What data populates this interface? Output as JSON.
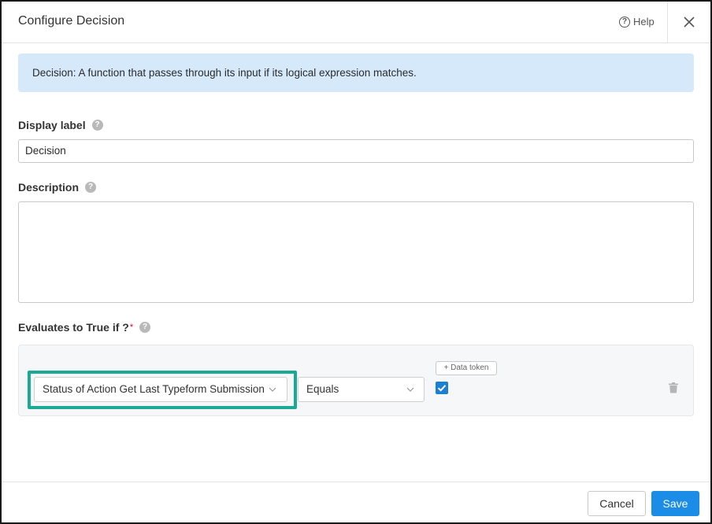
{
  "dialog": {
    "title": "Configure Decision",
    "help_label": "Help"
  },
  "info_banner": {
    "text": "Decision: A function that passes through its input if its logical expression matches."
  },
  "fields": {
    "display_label": {
      "label": "Display label",
      "value": "Decision"
    },
    "description": {
      "label": "Description",
      "value": ""
    },
    "evaluates": {
      "label": "Evaluates to True if ?",
      "required_mark": "*"
    }
  },
  "condition": {
    "left_operand": "Status of Action Get Last Typeform Submission",
    "operator": "Equals",
    "data_token_label": "+ Data token",
    "value_checked": true
  },
  "footer": {
    "cancel_label": "Cancel",
    "save_label": "Save"
  },
  "colors": {
    "accent": "#1b8de6",
    "highlight": "#1aa994",
    "info_bg": "#d6e9fb"
  },
  "icons": [
    "help-circle-icon",
    "close-icon",
    "question-icon",
    "chevron-down-icon",
    "checkmark-icon",
    "trash-icon"
  ]
}
